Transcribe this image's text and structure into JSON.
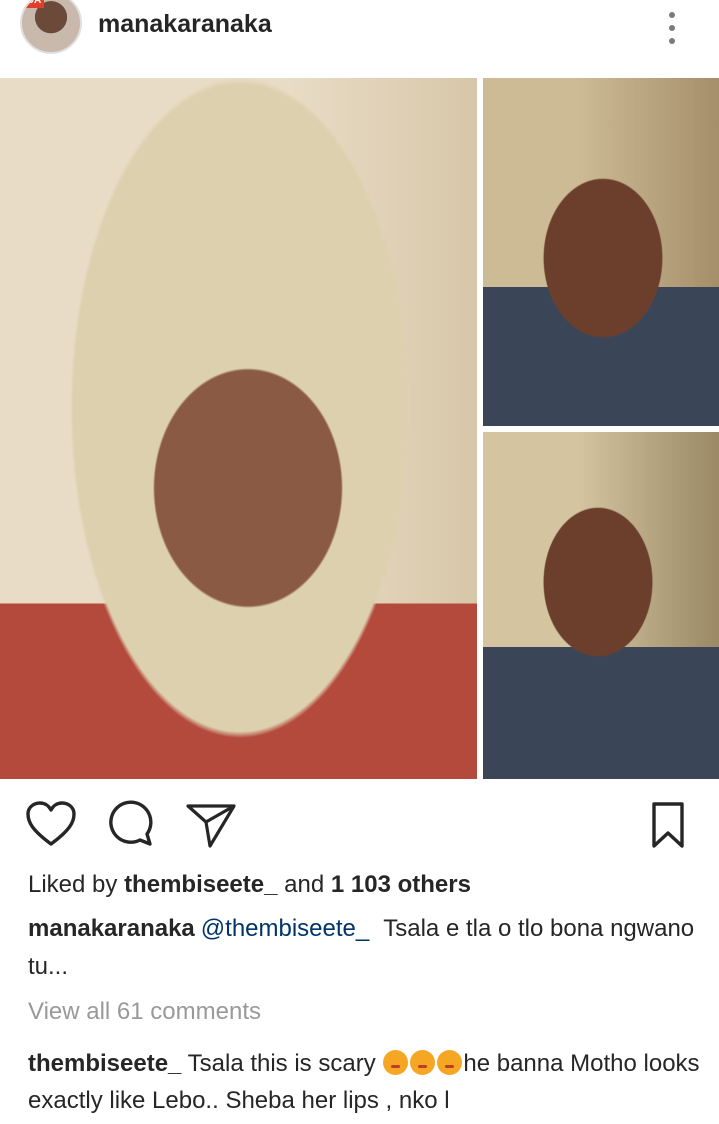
{
  "header": {
    "username": "manakaranaka",
    "avatar_badge": "DA"
  },
  "actions": {
    "like_icon": "heart-outline-icon",
    "comment_icon": "comment-bubble-icon",
    "share_icon": "paper-plane-icon",
    "save_icon": "bookmark-icon"
  },
  "likes": {
    "prefix": "Liked by",
    "user": "thembiseete_",
    "middle": "and",
    "others": "1 103 others"
  },
  "caption": {
    "username": "manakaranaka",
    "mention": "@thembiseete_",
    "text": "Tsala e tla o tlo bona ngwano tu..."
  },
  "view_all": "View all 61 comments",
  "comment": {
    "username": "thembiseete_",
    "text_before": "Tsala this is scary",
    "emoji_name": "angry-face-emoji",
    "text_after": "he banna Motho looks  exactly like Lebo.. Sheba her lips , nko l"
  },
  "colors": {
    "text": "#262626",
    "mention": "#003569",
    "muted": "#999999"
  }
}
